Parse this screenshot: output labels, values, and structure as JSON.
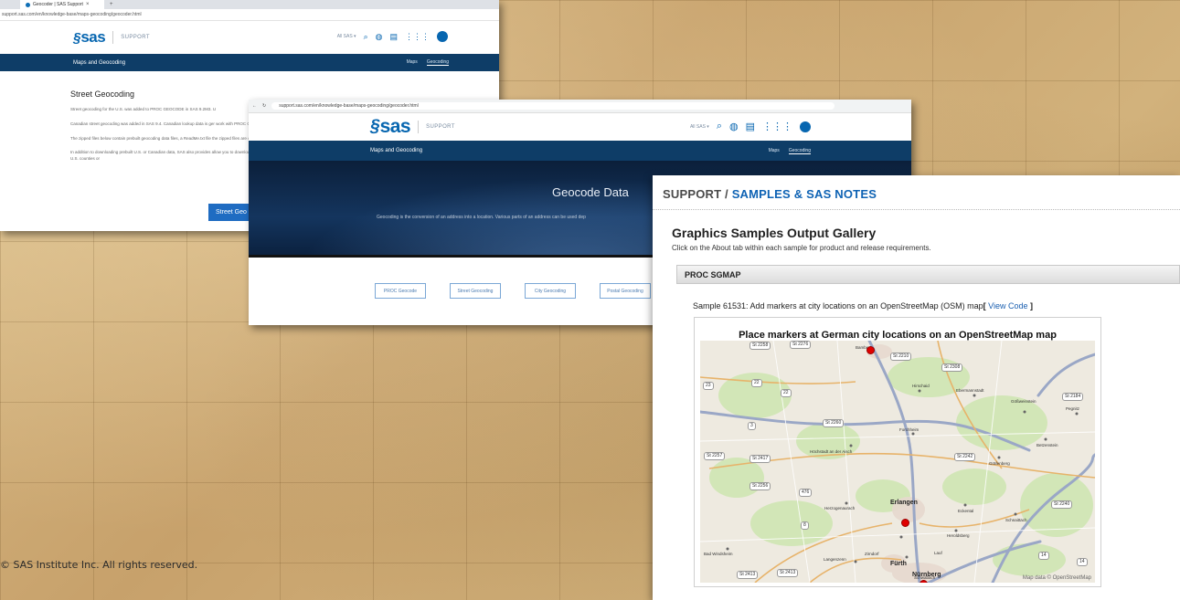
{
  "slide": {
    "copyright": "© SAS Institute Inc. All rights reserved."
  },
  "window1": {
    "tab_title": "Geocoder | SAS Support",
    "address": "support.sas.com/en/knowledge-base/maps-geocoding/geocoder.html",
    "support_label": "SUPPORT",
    "all_sas": "All SAS ▾",
    "nav_title": "Maps and Geocoding",
    "nav_links": [
      "Maps",
      "Geocoding"
    ],
    "heading": "Street Geocoding",
    "paragraphs": [
      "Street geocoding for the U.S. was added to PROC GEOCODE in SAS 9.2M3. U",
      "Canadian street geocoding was added in SAS 9.4. Canadian lookup data is ger work with PROC GEOCODE releases prior to SAS 9.4.",
      "The zipped files below contain prebuilt geocoding data files, a ReadMe.txt file the zipped files are over 2 GB.",
      "In addition to downloading prebuilt U.S. or Canadian data, SAS also provides allow you to download TIGER or NRN shapefiles for specific U.S. counties or"
    ],
    "button": "Street Geo"
  },
  "window2": {
    "address": "support.sas.com/en/knowledge-base/maps-geocoding/geocoder.html",
    "support_label": "SUPPORT",
    "all_sas": "All SAS ▾",
    "nav_title": "Maps and Geocoding",
    "nav_links": [
      "Maps",
      "Geocoding"
    ],
    "hero_title": "Geocode Data",
    "hero_sub": "Geocoding is the conversion of an address into a location. Various parts of an address can be used dep",
    "buttons": [
      "PROC Geocode",
      "Street Geocoding",
      "City Geocoding",
      "Postal Geocoding"
    ]
  },
  "window3": {
    "crumb_a": "SUPPORT / ",
    "crumb_b": "SAMPLES & SAS NOTES",
    "gallery_title": "Graphics Samples Output Gallery",
    "gallery_sub": "Click on the About tab within each sample for product and release requirements.",
    "proc": "PROC SGMAP",
    "sample": "Sample 61531: Add markers at city locations on an OpenStreetMap (OSM) map",
    "view_code_open": "[ ",
    "view_code": "View Code",
    "view_code_close": " ]",
    "map_title": "Place markers at German city locations on an OpenStreetMap map",
    "attribution": "Map data © OpenStreetMap",
    "road_labels": [
      "St 2258",
      "St 2276",
      "St 2210",
      "St 2308",
      "St 2184",
      "23",
      "22",
      "22",
      "St 2260",
      "3",
      "St 2257",
      "St 2417",
      "St 2256",
      "476",
      "St 2242",
      "St 2240",
      "8",
      "14",
      "St 2413",
      "St 2413",
      "14"
    ],
    "cities": [
      "Bamberg",
      "Hirschaid",
      "Ebermannstadt",
      "Gößweinstein",
      "Pegnitz",
      "Höchstadt an der Aisch",
      "Forchheim",
      "Gräfenberg",
      "Betzenstein",
      "Herzogenaurach",
      "Eckental",
      "Schnaittach",
      "Lauf",
      "Heroldsberg",
      "Schwabach",
      "Zirndorf",
      "Langenzenn",
      "Bad Windsheim",
      "Erlangen",
      "Fürth",
      "Nürnberg"
    ],
    "big_cities": [
      "Erlangen",
      "Fürth",
      "Nürnberg"
    ]
  }
}
